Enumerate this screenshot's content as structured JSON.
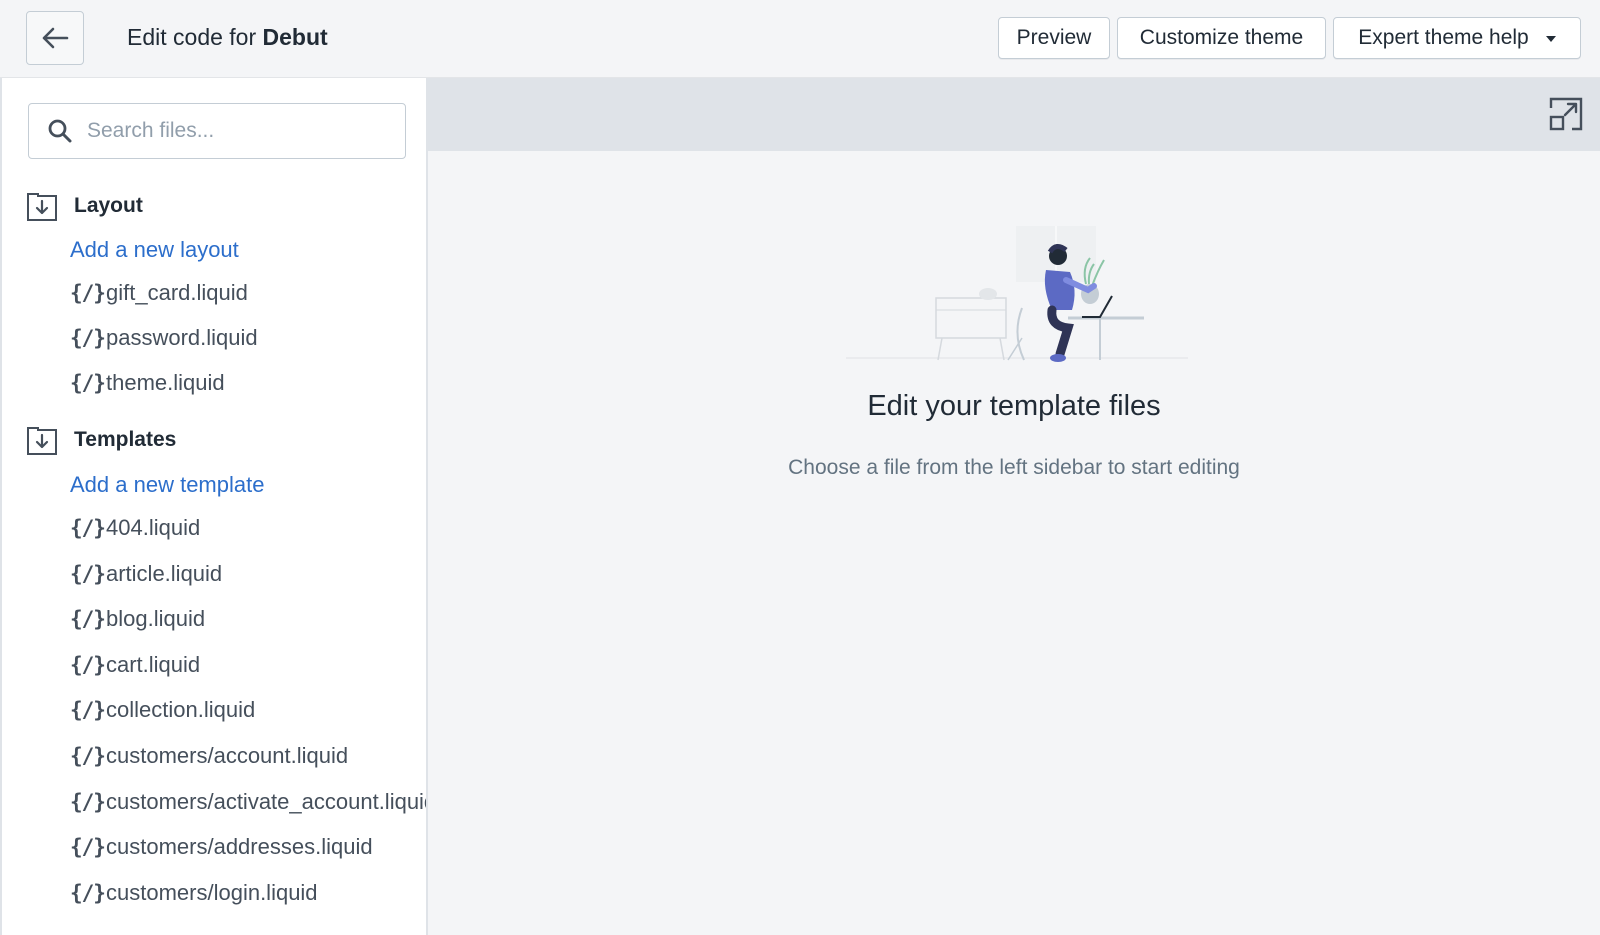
{
  "header": {
    "title_prefix": "Edit code for",
    "theme_name": "Debut",
    "back_icon": "arrow-left-icon",
    "buttons": {
      "preview": "Preview",
      "customize": "Customize theme",
      "help": "Expert theme help"
    }
  },
  "sidebar": {
    "search": {
      "placeholder": "Search files...",
      "value": ""
    },
    "sections": [
      {
        "label": "Layout",
        "add_label": "Add a new layout",
        "files": [
          "gift_card.liquid",
          "password.liquid",
          "theme.liquid"
        ]
      },
      {
        "label": "Templates",
        "add_label": "Add a new template",
        "files": [
          "404.liquid",
          "article.liquid",
          "blog.liquid",
          "cart.liquid",
          "collection.liquid",
          "customers/account.liquid",
          "customers/activate_account.liquid",
          "customers/addresses.liquid",
          "customers/login.liquid"
        ]
      }
    ],
    "file_icon_glyph": "{/}"
  },
  "main": {
    "empty_state": {
      "title": "Edit your template files",
      "subtitle": "Choose a file from the left sidebar to start editing"
    }
  },
  "colors": {
    "link": "#2c6ecb",
    "text": "#212b36",
    "subdued": "#637381",
    "toolbar": "#dfe3e8",
    "illustration_accent": "#5c6ac4"
  }
}
